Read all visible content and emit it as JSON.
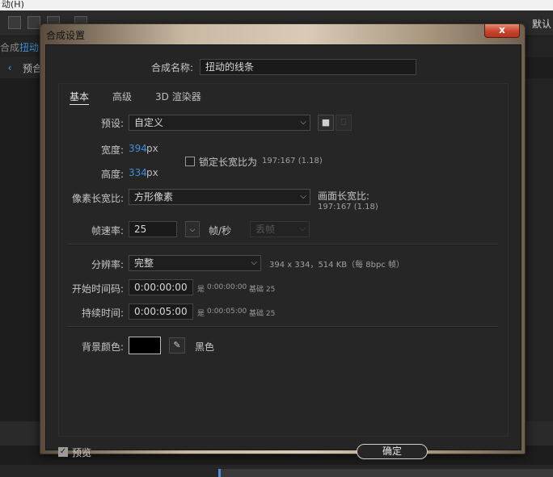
{
  "background": {
    "menu_item": "动(H)",
    "toolbar_right": "默认",
    "panel_tab_prefix": "合成",
    "panel_tab_name": "扭动",
    "breadcrumb_label": "预合"
  },
  "dialog": {
    "title": "合成设置",
    "close_label": "x",
    "comp_name_label": "合成名称:",
    "comp_name_value": "扭动的线条",
    "tabs": [
      {
        "label": "基本",
        "active": true
      },
      {
        "label": "高级",
        "active": false
      },
      {
        "label": "3D 渲染器",
        "active": false
      }
    ],
    "preset": {
      "label": "预设:",
      "value": "自定义",
      "save_icon": "save-preset-icon",
      "delete_icon": "trash-icon"
    },
    "width": {
      "label": "宽度:",
      "value": "394",
      "unit": "px"
    },
    "height": {
      "label": "高度:",
      "value": "334",
      "unit": "px"
    },
    "lock_aspect": {
      "label": "锁定长宽比为",
      "value": "197:167 (1.18)",
      "checked": false
    },
    "pixel_aspect": {
      "label": "像素长宽比:",
      "value": "方形像素",
      "frame_aspect_label": "画面长宽比:",
      "frame_aspect_value": "197:167 (1.18)"
    },
    "frame_rate": {
      "label": "帧速率:",
      "value": "25",
      "unit": "帧/秒",
      "drop_frame_value": "丢帧"
    },
    "resolution": {
      "label": "分辨率:",
      "value": "完整",
      "info": "394 x 334，514 KB（每 8bpc 帧）"
    },
    "start_timecode": {
      "label": "开始时间码:",
      "value": "0:00:00:00",
      "info_prefix": "是",
      "info_value": "0:00:00:00",
      "info_base": "基础 25"
    },
    "duration": {
      "label": "持续时间:",
      "value": "0:00:05:00",
      "info_prefix": "是",
      "info_value": "0:00:05:00",
      "info_base": "基础 25"
    },
    "background_color": {
      "label": "背景颜色:",
      "color": "#000000",
      "color_name": "黑色",
      "eyedropper_icon": "eyedropper-icon"
    },
    "preview": {
      "label": "预览",
      "checked": true
    },
    "ok_label": "确定"
  }
}
